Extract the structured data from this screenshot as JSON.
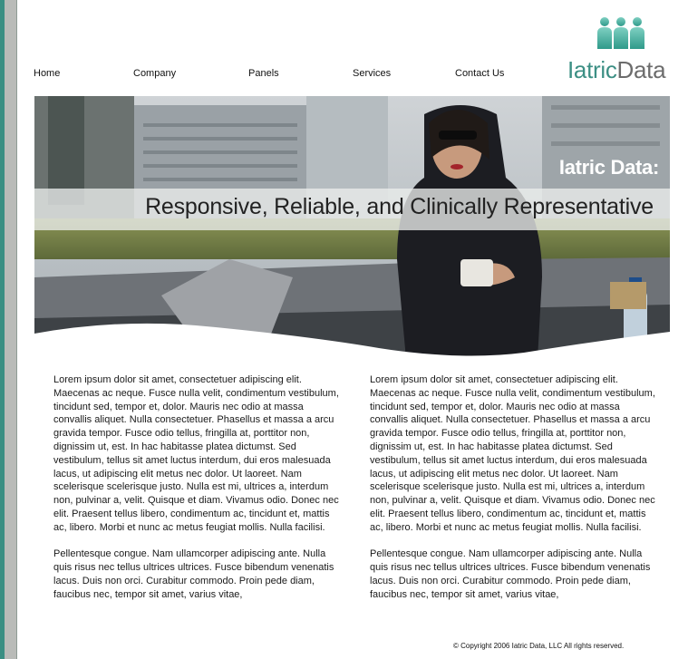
{
  "logo": {
    "brand_part1": "Iatric",
    "brand_part2": "Data",
    "colors": {
      "primary": "#3c8f84",
      "secondary": "#6c6c6c"
    }
  },
  "nav": {
    "items": [
      {
        "label": "Home"
      },
      {
        "label": "Company"
      },
      {
        "label": "Panels"
      },
      {
        "label": "Services"
      },
      {
        "label": "Contact Us"
      }
    ]
  },
  "hero": {
    "title": "Iatric Data:",
    "subtitle": "Responsive, Reliable, and Clinically Representative"
  },
  "content": {
    "left": {
      "p1": "Lorem ipsum dolor sit amet, consectetuer adipiscing elit. Maecenas ac neque. Fusce nulla velit, condimentum vestibulum, tincidunt sed, tempor et, dolor. Mauris nec odio at massa convallis aliquet. Nulla consectetuer. Phasellus et massa a arcu gravida tempor. Fusce odio tellus, fringilla at, porttitor non, dignissim ut, est. In hac habitasse platea dictumst. Sed vestibulum, tellus sit amet luctus interdum, dui eros malesuada lacus, ut adipiscing elit metus nec dolor. Ut laoreet. Nam scelerisque scelerisque justo. Nulla est mi, ultrices a, interdum non, pulvinar a, velit. Quisque et diam. Vivamus odio. Donec nec elit. Praesent tellus libero, condimentum ac, tincidunt et, mattis ac, libero. Morbi et nunc ac metus feugiat mollis. Nulla facilisi.",
      "p2": "Pellentesque congue. Nam ullamcorper adipiscing ante. Nulla quis risus nec tellus ultrices ultrices. Fusce bibendum venenatis lacus. Duis non orci. Curabitur commodo. Proin pede diam, faucibus nec, tempor sit amet, varius vitae,"
    },
    "right": {
      "p1": "Lorem ipsum dolor sit amet, consectetuer adipiscing elit. Maecenas ac neque. Fusce nulla velit, condimentum vestibulum, tincidunt sed, tempor et, dolor. Mauris nec odio at massa convallis aliquet. Nulla consectetuer. Phasellus et massa a arcu gravida tempor. Fusce odio tellus, fringilla at, porttitor non, dignissim ut, est. In hac habitasse platea dictumst. Sed vestibulum, tellus sit amet luctus interdum, dui eros malesuada lacus, ut adipiscing elit metus nec dolor. Ut laoreet. Nam scelerisque scelerisque justo. Nulla est mi, ultrices a, interdum non, pulvinar a, velit. Quisque et diam. Vivamus odio. Donec nec elit. Praesent tellus libero, condimentum ac, tincidunt et, mattis ac, libero. Morbi et nunc ac metus feugiat mollis. Nulla facilisi.",
      "p2": "Pellentesque congue. Nam ullamcorper adipiscing ante. Nulla quis risus nec tellus ultrices ultrices. Fusce bibendum venenatis lacus. Duis non orci. Curabitur commodo. Proin pede diam, faucibus nec, tempor sit amet, varius vitae,"
    }
  },
  "footer": {
    "copyright": "© Copyright 2006 Iatric Data, LLC All rights reserved."
  }
}
